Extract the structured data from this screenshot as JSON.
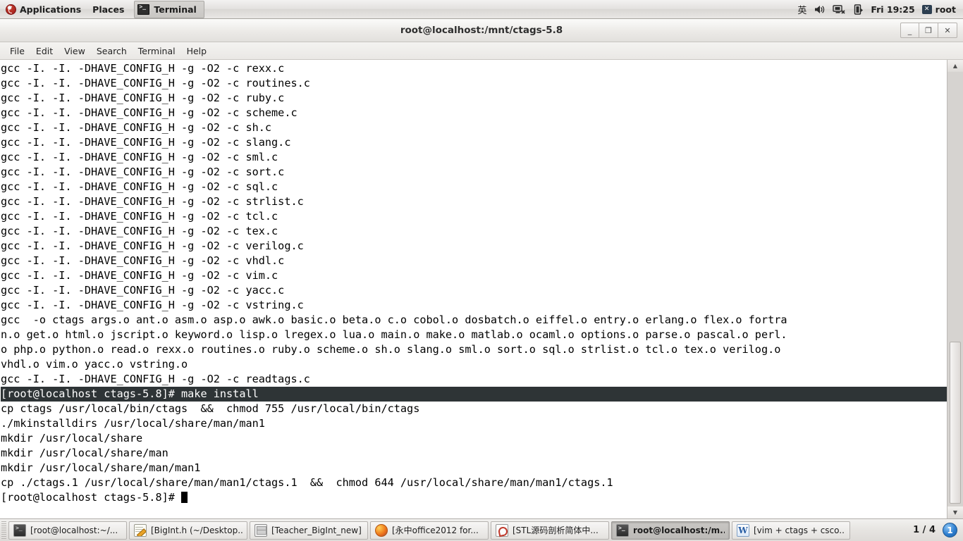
{
  "top_panel": {
    "logo_icon": "fedora-logo-icon",
    "applications_label": "Applications",
    "places_label": "Places",
    "active_window_task": "Terminal",
    "tray": {
      "ime_label": "英",
      "volume_icon": "speaker-icon",
      "network_icon": "network-disconnected-icon",
      "battery_icon": "battery-icon",
      "clock": "Fri 19:25",
      "user_icon": "user-icon",
      "user_label": "root"
    }
  },
  "window": {
    "title": "root@localhost:/mnt/ctags-5.8",
    "buttons": {
      "minimize": "_",
      "maximize": "❐",
      "close": "✕"
    },
    "menubar": [
      "File",
      "Edit",
      "View",
      "Search",
      "Terminal",
      "Help"
    ]
  },
  "terminal": {
    "lines": [
      {
        "text": "gcc -I. -I. -DHAVE_CONFIG_H -g -O2 -c rexx.c",
        "highlight": false
      },
      {
        "text": "gcc -I. -I. -DHAVE_CONFIG_H -g -O2 -c routines.c",
        "highlight": false
      },
      {
        "text": "gcc -I. -I. -DHAVE_CONFIG_H -g -O2 -c ruby.c",
        "highlight": false
      },
      {
        "text": "gcc -I. -I. -DHAVE_CONFIG_H -g -O2 -c scheme.c",
        "highlight": false
      },
      {
        "text": "gcc -I. -I. -DHAVE_CONFIG_H -g -O2 -c sh.c",
        "highlight": false
      },
      {
        "text": "gcc -I. -I. -DHAVE_CONFIG_H -g -O2 -c slang.c",
        "highlight": false
      },
      {
        "text": "gcc -I. -I. -DHAVE_CONFIG_H -g -O2 -c sml.c",
        "highlight": false
      },
      {
        "text": "gcc -I. -I. -DHAVE_CONFIG_H -g -O2 -c sort.c",
        "highlight": false
      },
      {
        "text": "gcc -I. -I. -DHAVE_CONFIG_H -g -O2 -c sql.c",
        "highlight": false
      },
      {
        "text": "gcc -I. -I. -DHAVE_CONFIG_H -g -O2 -c strlist.c",
        "highlight": false
      },
      {
        "text": "gcc -I. -I. -DHAVE_CONFIG_H -g -O2 -c tcl.c",
        "highlight": false
      },
      {
        "text": "gcc -I. -I. -DHAVE_CONFIG_H -g -O2 -c tex.c",
        "highlight": false
      },
      {
        "text": "gcc -I. -I. -DHAVE_CONFIG_H -g -O2 -c verilog.c",
        "highlight": false
      },
      {
        "text": "gcc -I. -I. -DHAVE_CONFIG_H -g -O2 -c vhdl.c",
        "highlight": false
      },
      {
        "text": "gcc -I. -I. -DHAVE_CONFIG_H -g -O2 -c vim.c",
        "highlight": false
      },
      {
        "text": "gcc -I. -I. -DHAVE_CONFIG_H -g -O2 -c yacc.c",
        "highlight": false
      },
      {
        "text": "gcc -I. -I. -DHAVE_CONFIG_H -g -O2 -c vstring.c",
        "highlight": false
      },
      {
        "text": "gcc  -o ctags args.o ant.o asm.o asp.o awk.o basic.o beta.o c.o cobol.o dosbatch.o eiffel.o entry.o erlang.o flex.o fortra",
        "highlight": false
      },
      {
        "text": "n.o get.o html.o jscript.o keyword.o lisp.o lregex.o lua.o main.o make.o matlab.o ocaml.o options.o parse.o pascal.o perl.",
        "highlight": false
      },
      {
        "text": "o php.o python.o read.o rexx.o routines.o ruby.o scheme.o sh.o slang.o sml.o sort.o sql.o strlist.o tcl.o tex.o verilog.o",
        "highlight": false
      },
      {
        "text": "vhdl.o vim.o yacc.o vstring.o",
        "highlight": false
      },
      {
        "text": "gcc -I. -I. -DHAVE_CONFIG_H -g -O2 -c readtags.c",
        "highlight": false
      },
      {
        "text": "[root@localhost ctags-5.8]# make install",
        "highlight": true
      },
      {
        "text": "cp ctags /usr/local/bin/ctags  &&  chmod 755 /usr/local/bin/ctags",
        "highlight": false
      },
      {
        "text": "./mkinstalldirs /usr/local/share/man/man1",
        "highlight": false
      },
      {
        "text": "mkdir /usr/local/share",
        "highlight": false
      },
      {
        "text": "mkdir /usr/local/share/man",
        "highlight": false
      },
      {
        "text": "mkdir /usr/local/share/man/man1",
        "highlight": false
      },
      {
        "text": "cp ./ctags.1 /usr/local/share/man/man1/ctags.1  &&  chmod 644 /usr/local/share/man/man1/ctags.1",
        "highlight": false
      }
    ],
    "prompt": "[root@localhost ctags-5.8]# ",
    "cursor": "block-cursor",
    "colors": {
      "background": "#ffffff",
      "foreground": "#000000",
      "selection_background": "#2e3436",
      "selection_foreground": "#ffffff"
    },
    "scrollbar": {
      "up_arrow": "▲",
      "down_arrow": "▼"
    }
  },
  "taskbar": {
    "items": [
      {
        "label": "[root@localhost:~/...",
        "icon": "terminal-icon",
        "icon_class": "ico-term",
        "active": false
      },
      {
        "label": "[BigInt.h (~/Desktop...",
        "icon": "text-editor-icon",
        "icon_class": "ico-gedit",
        "active": false
      },
      {
        "label": "[Teacher_BigInt_new]",
        "icon": "file-manager-icon",
        "icon_class": "ico-files",
        "active": false
      },
      {
        "label": "[永中office2012 for...",
        "icon": "firefox-icon",
        "icon_class": "ico-firefox",
        "active": false
      },
      {
        "label": "[STL源码剖析简体中...",
        "icon": "pdf-reader-icon",
        "icon_class": "ico-pdf",
        "active": false
      },
      {
        "label": "root@localhost:/m...",
        "icon": "terminal-icon",
        "icon_class": "ico-term",
        "active": true
      },
      {
        "label": "[vim + ctags + csco...",
        "icon": "word-document-icon",
        "icon_class": "ico-word",
        "active": false
      }
    ],
    "workspace_indicator": "1 / 4",
    "notification_count": "1"
  }
}
